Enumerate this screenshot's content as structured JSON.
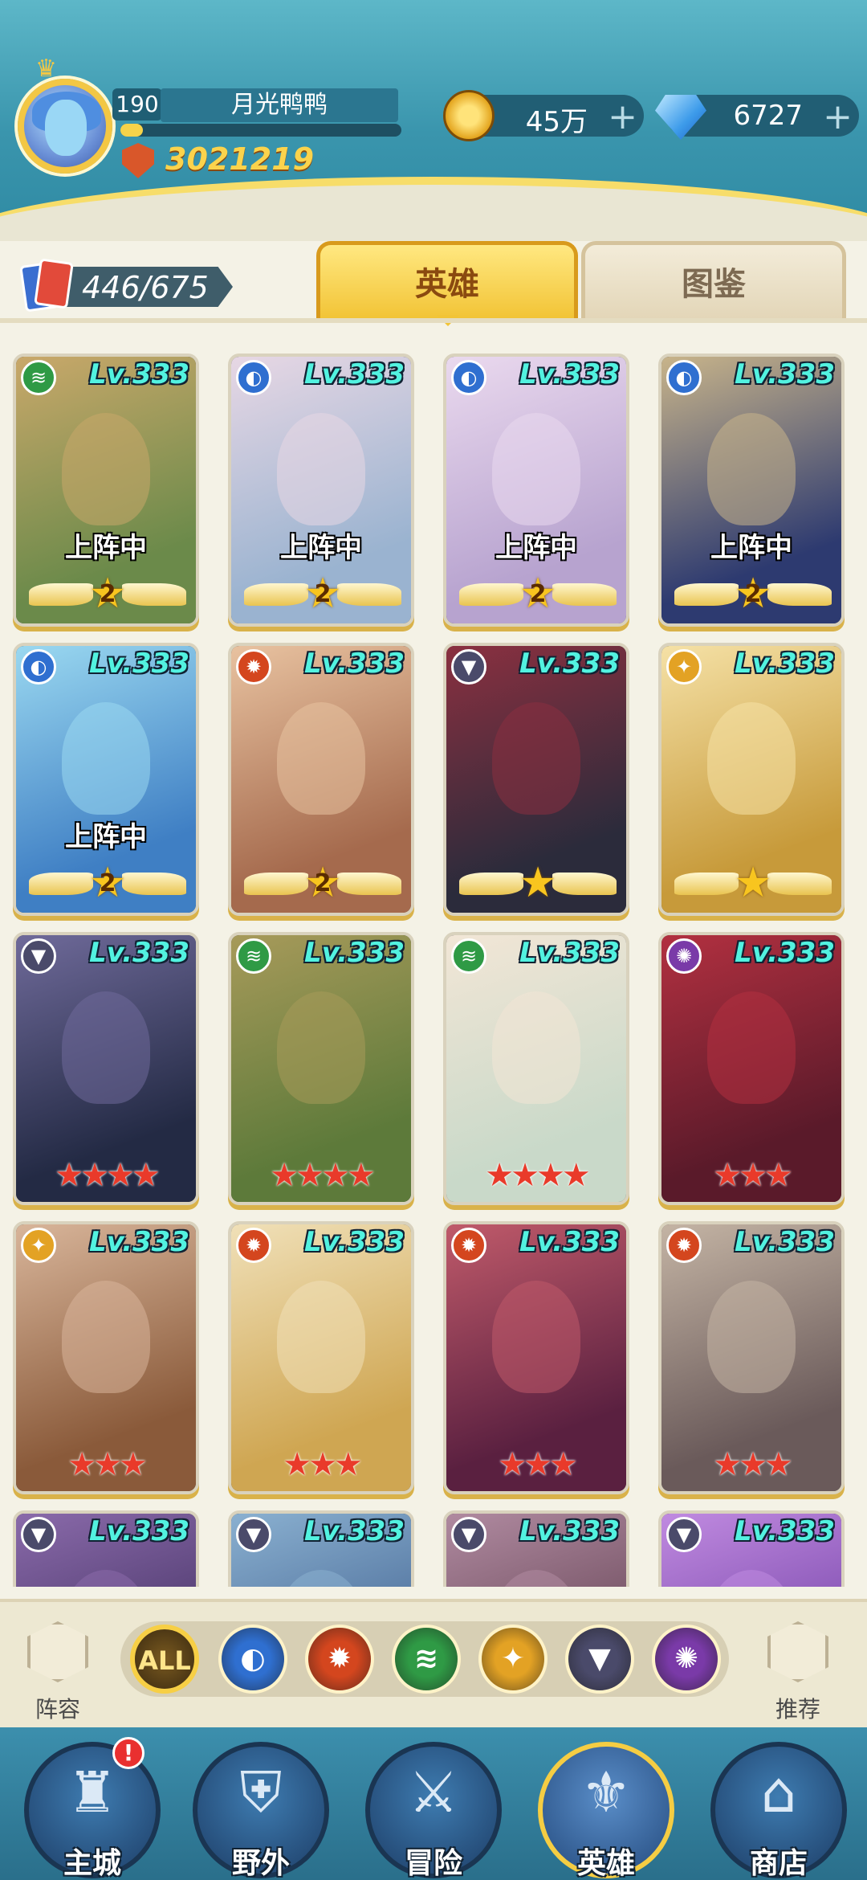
{
  "player": {
    "level": "190",
    "name": "月光鸭鸭",
    "exp_fraction": 0.08,
    "power": "3021219"
  },
  "resources": {
    "gold": "45万",
    "gems": "6727",
    "plus": "+"
  },
  "collection": {
    "count": "446/675"
  },
  "tabs": {
    "heroes": "英雄",
    "codex": "图鉴"
  },
  "heroes": [
    {
      "level": "Lv.333",
      "element": "wind",
      "deployed": true,
      "stars": 2,
      "bg": [
        "#6b8a4a",
        "#c9a86a"
      ]
    },
    {
      "level": "Lv.333",
      "element": "water",
      "deployed": true,
      "stars": 2,
      "bg": [
        "#9ab3d0",
        "#e7d7e4"
      ]
    },
    {
      "level": "Lv.333",
      "element": "water",
      "deployed": true,
      "stars": 2,
      "bg": [
        "#b7a3cf",
        "#ead9ee"
      ]
    },
    {
      "level": "Lv.333",
      "element": "water",
      "deployed": true,
      "stars": 2,
      "bg": [
        "#2d3a70",
        "#c8b48a"
      ]
    },
    {
      "level": "Lv.333",
      "element": "water",
      "deployed": true,
      "stars": 2,
      "bg": [
        "#3f7fc4",
        "#9ad8f0"
      ]
    },
    {
      "level": "Lv.333",
      "element": "fire",
      "deployed": false,
      "stars": 2,
      "bg": [
        "#a56a4d",
        "#e8c2a0"
      ]
    },
    {
      "level": "Lv.333",
      "element": "shadow",
      "deployed": false,
      "stars": 1,
      "bg": [
        "#2b2b3b",
        "#8b3040"
      ]
    },
    {
      "level": "Lv.333",
      "element": "light",
      "deployed": false,
      "stars": 1,
      "bg": [
        "#c79a3a",
        "#f5e1a6"
      ]
    },
    {
      "level": "Lv.333",
      "element": "shadow",
      "deployed": false,
      "stars": 4,
      "bg": [
        "#232a44",
        "#6f6a9a"
      ],
      "red_stars": true
    },
    {
      "level": "Lv.333",
      "element": "wind",
      "deployed": false,
      "stars": 4,
      "bg": [
        "#5d7a3a",
        "#a79a5a"
      ],
      "red_stars": true
    },
    {
      "level": "Lv.333",
      "element": "wind",
      "deployed": false,
      "stars": 4,
      "bg": [
        "#c9d9c9",
        "#f2e6d6"
      ],
      "red_stars": true
    },
    {
      "level": "Lv.333",
      "element": "void",
      "deployed": false,
      "stars": 3,
      "bg": [
        "#5a1a2a",
        "#b23040"
      ],
      "red_stars": true
    },
    {
      "level": "Lv.333",
      "element": "light",
      "deployed": false,
      "stars": 3,
      "bg": [
        "#8a5a3a",
        "#d8b59a"
      ],
      "red_stars": true
    },
    {
      "level": "Lv.333",
      "element": "fire",
      "deployed": false,
      "stars": 3,
      "bg": [
        "#cfa652",
        "#f0e0b8"
      ],
      "red_stars": true
    },
    {
      "level": "Lv.333",
      "element": "fire",
      "deployed": false,
      "stars": 3,
      "bg": [
        "#5a2040",
        "#c05a6a"
      ],
      "red_stars": true
    },
    {
      "level": "Lv.333",
      "element": "fire",
      "deployed": false,
      "stars": 3,
      "bg": [
        "#6a5a5a",
        "#c4b4a4"
      ],
      "red_stars": true
    },
    {
      "level": "Lv.333",
      "element": "shadow",
      "deployed": false,
      "stars": 0,
      "bg": [
        "#3a2a5a",
        "#8a6aaa"
      ]
    },
    {
      "level": "Lv.333",
      "element": "shadow",
      "deployed": false,
      "stars": 0,
      "bg": [
        "#3a5a8a",
        "#8ab0d0"
      ]
    },
    {
      "level": "Lv.333",
      "element": "shadow",
      "deployed": false,
      "stars": 0,
      "bg": [
        "#5a3a4a",
        "#b08aa0"
      ]
    },
    {
      "level": "Lv.333",
      "element": "shadow",
      "deployed": false,
      "stars": 0,
      "bg": [
        "#6a3aa0",
        "#c08ae0"
      ]
    }
  ],
  "hero_labels": {
    "deployed": "上阵中"
  },
  "filters": {
    "left_label": "阵容",
    "right_label": "推荐",
    "all_label": "ALL",
    "factions": [
      {
        "name": "water",
        "color": "#2f6fd0",
        "glyph": "◐"
      },
      {
        "name": "fire",
        "color": "#d4461e",
        "glyph": "✹"
      },
      {
        "name": "wind",
        "color": "#2f9a45",
        "glyph": "≋"
      },
      {
        "name": "light",
        "color": "#e3a224",
        "glyph": "✦"
      },
      {
        "name": "shadow",
        "color": "#4a4a6a",
        "glyph": "▼"
      },
      {
        "name": "void",
        "color": "#7a3aa8",
        "glyph": "✺"
      }
    ]
  },
  "element_colors": {
    "wind": "#2f9a45",
    "water": "#2f6fd0",
    "fire": "#d4461e",
    "shadow": "#4a4a6a",
    "light": "#e3a224",
    "void": "#7a3aa8"
  },
  "element_glyphs": {
    "wind": "≋",
    "water": "◐",
    "fire": "✹",
    "shadow": "▼",
    "light": "✦",
    "void": "✺"
  },
  "nav": {
    "badge": "!",
    "items": [
      {
        "label": "主城",
        "glyph": "♜",
        "active": false
      },
      {
        "label": "野外",
        "glyph": "⛨",
        "active": false
      },
      {
        "label": "冒险",
        "glyph": "⚔",
        "active": false
      },
      {
        "label": "英雄",
        "glyph": "⚜",
        "active": true
      },
      {
        "label": "商店",
        "glyph": "⌂",
        "active": false
      }
    ]
  }
}
